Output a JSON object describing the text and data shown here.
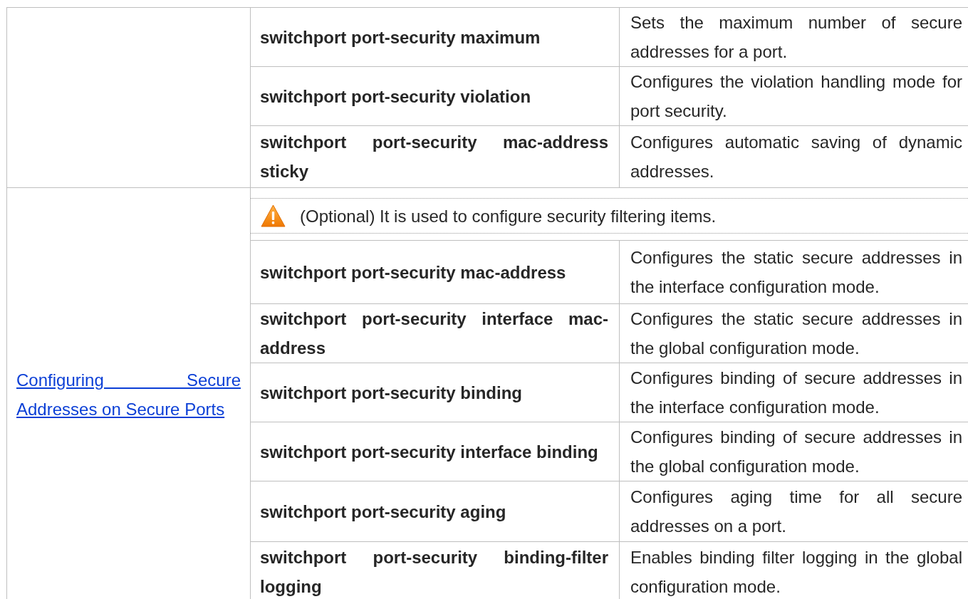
{
  "sections": [
    {
      "rows": [
        {
          "command": "switchport port-security maximum",
          "description": "Sets the maximum number of secure addresses for a port."
        },
        {
          "command": "switchport port-security violation",
          "description": "Configures the violation handling mode for port security."
        },
        {
          "command": "switchport port-security mac-address sticky",
          "description": "Configures automatic saving of dynamic addresses."
        }
      ]
    },
    {
      "task_link": "Configuring Secure Addresses on Secure Ports",
      "note": "(Optional) It is used to configure security filtering items.",
      "rows": [
        {
          "command": "switchport port-security mac-address",
          "description": "Configures the static secure addresses in the interface configuration mode."
        },
        {
          "command": "switchport port-security interface mac-address",
          "description": "Configures the static secure addresses in the global configuration mode."
        },
        {
          "command": "switchport port-security binding",
          "description": "Configures binding of secure addresses in the interface configuration mode."
        },
        {
          "command": "switchport port-security interface binding",
          "description": "Configures binding of secure addresses in the global configuration mode."
        },
        {
          "command": "switchport port-security aging",
          "description": "Configures aging time for all secure addresses on a port."
        },
        {
          "command": "switchport port-security binding-filter logging",
          "description": "Enables binding filter logging in the global configuration mode."
        }
      ]
    }
  ]
}
